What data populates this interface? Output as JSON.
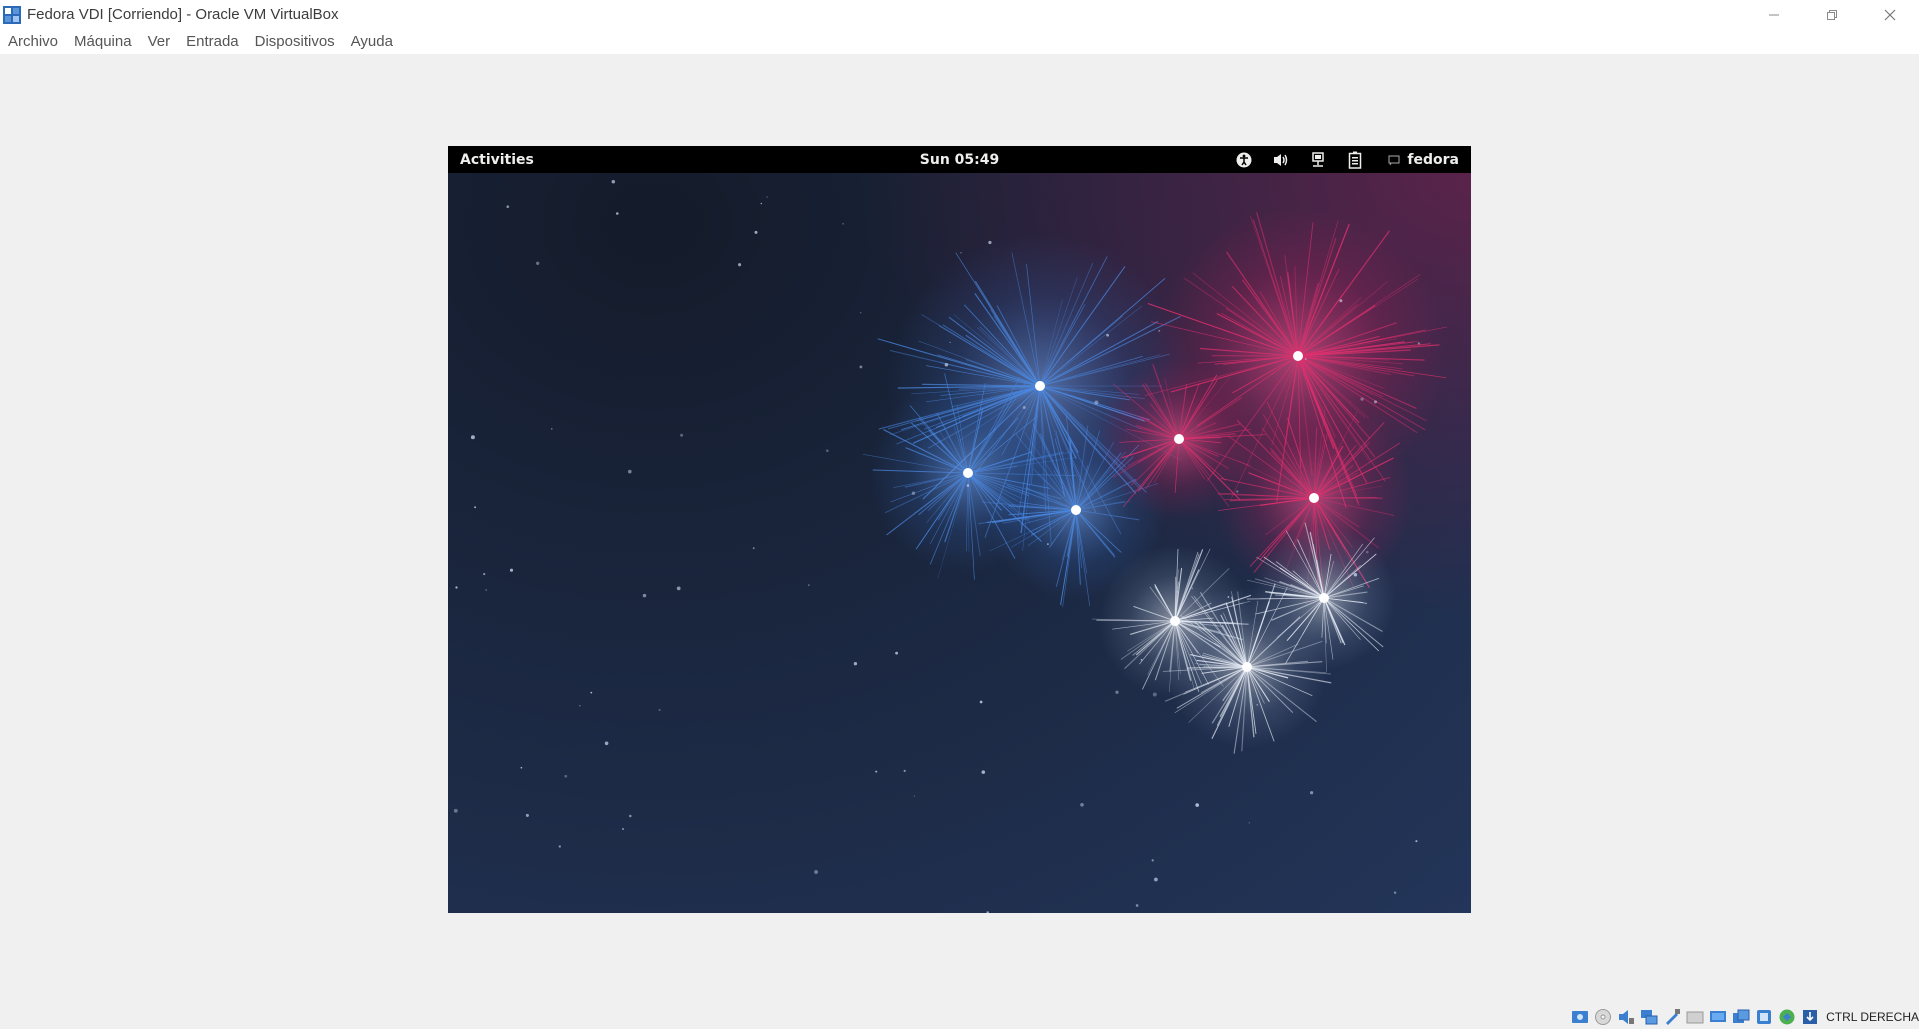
{
  "window": {
    "title": "Fedora VDI [Corriendo] - Oracle VM VirtualBox",
    "controls": [
      "minimize-icon",
      "restore-icon",
      "close-icon"
    ]
  },
  "menu": {
    "items": [
      "Archivo",
      "Máquina",
      "Ver",
      "Entrada",
      "Dispositivos",
      "Ayuda"
    ]
  },
  "guest": {
    "topbar": {
      "activities": "Activities",
      "clock": "Sun 05:49",
      "tray_icons": [
        "accessibility-icon",
        "volume-icon",
        "network-icon",
        "battery-icon",
        "user-status-icon"
      ],
      "user": "fedora"
    },
    "wallpaper": "fireworks"
  },
  "statusbar": {
    "icons": [
      "hard-disk-icon",
      "optical-drive-icon",
      "audio-icon",
      "network-adapter-icon",
      "usb-icon",
      "shared-folders-icon",
      "display-icon",
      "video-capture-icon",
      "virtualization-icon",
      "mouse-integration-icon",
      "keyboard-capture-icon"
    ],
    "host_key": "CTRL DERECHA"
  },
  "colors": {
    "titlebar_bg": "#ffffff",
    "window_bg": "#f0f0f0",
    "gnome_bar": "#000000",
    "firework_blue": "#4a88e0",
    "firework_pink": "#e0306e",
    "firework_white": "#e8eef8"
  }
}
